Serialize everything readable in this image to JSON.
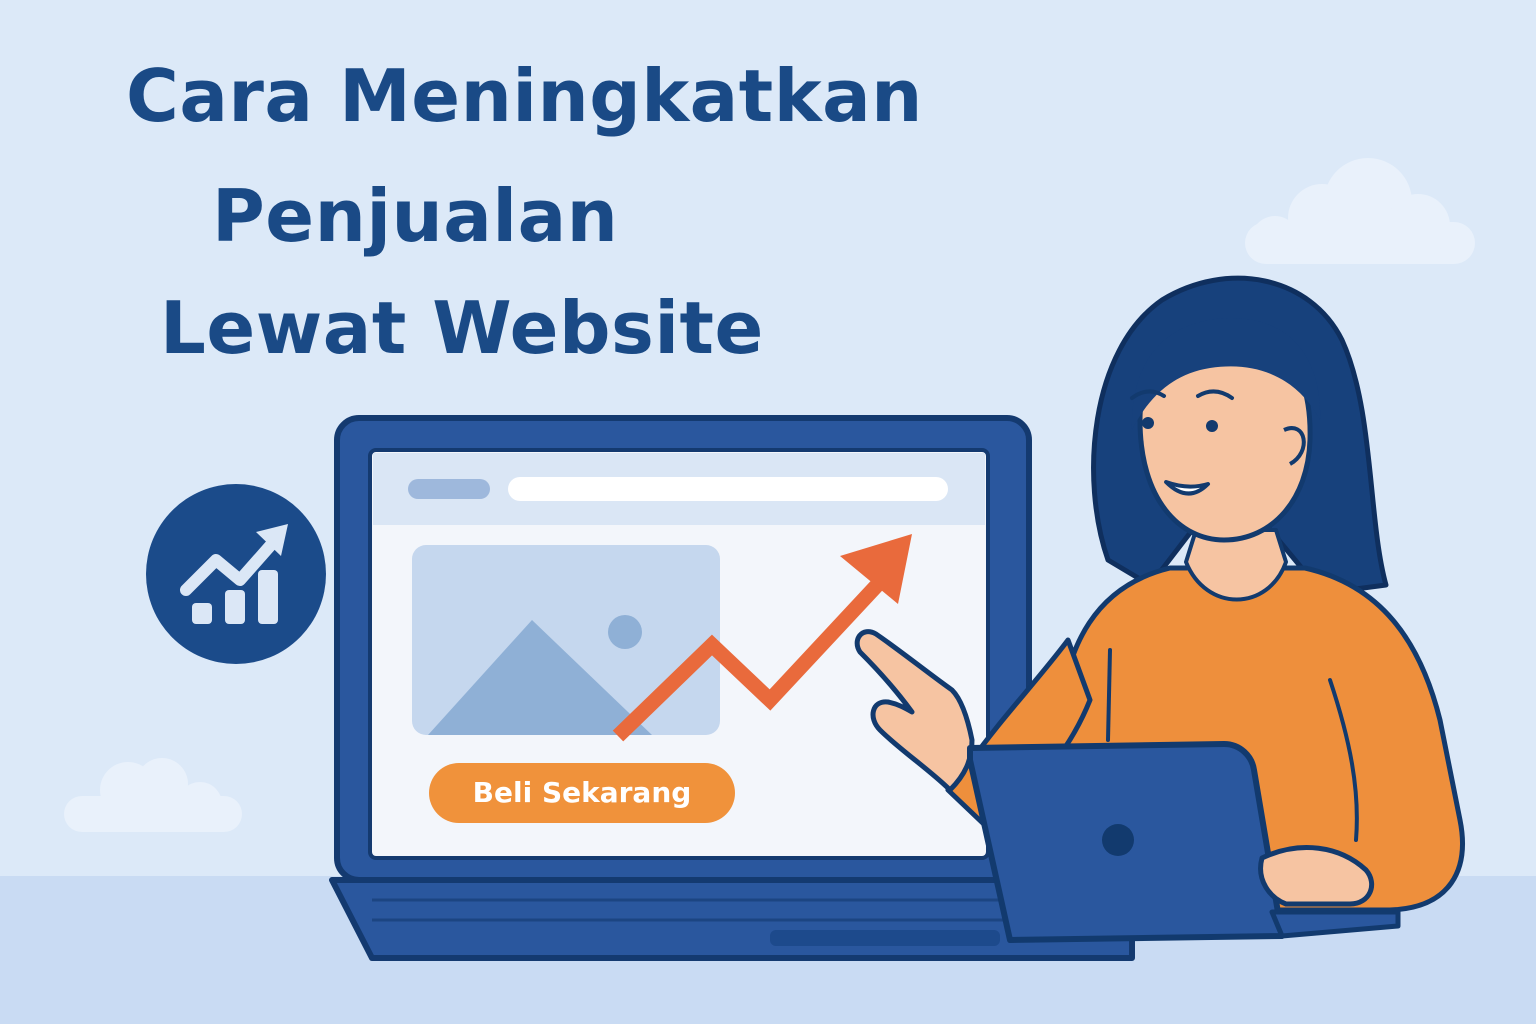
{
  "title": {
    "line1": "Cara Meningkatkan",
    "line2": "Penjualan",
    "line3": "Lewat Website"
  },
  "website": {
    "cta_label": "Beli Sekarang"
  },
  "icons": {
    "growth_badge": "growth-chart-icon",
    "image_placeholder": "image-icon",
    "trend": "trend-up-arrow",
    "laptop_logo": "laptop-logo-icon"
  },
  "colors": {
    "background": "#dce9f8",
    "title": "#1a4a86",
    "laptop": "#2a579e",
    "accent": "#e96a3c",
    "button": "#f0923b",
    "sweater": "#ee8f3c",
    "skin": "#f6c4a2",
    "hair": "#17417c"
  }
}
